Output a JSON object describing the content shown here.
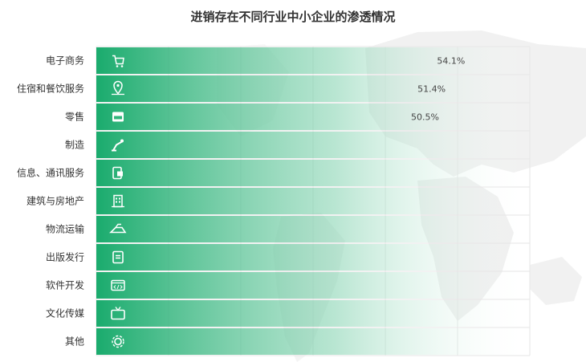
{
  "chart_data": {
    "type": "bar",
    "orientation": "horizontal",
    "title": "进销存在不同行业中小企业的渗透情况",
    "categories": [
      "电子商务",
      "住宿和餐饮服务",
      "零售",
      "制造",
      "信息、通讯服务",
      "建筑与房地产",
      "物流运输",
      "出版发行",
      "软件开发",
      "文化传媒",
      "其他"
    ],
    "icons": [
      "shopping-cart-icon",
      "map-pin-icon",
      "storefront-icon",
      "robot-arm-icon",
      "mobile-phone-icon",
      "building-icon",
      "speedboat-icon",
      "book-icon",
      "code-window-icon",
      "tv-icon",
      "gear-icon"
    ],
    "values": [
      54.1,
      51.4,
      50.5,
      null,
      null,
      null,
      null,
      null,
      null,
      null,
      null
    ],
    "value_labels": [
      "54.1%",
      "51.4%",
      "50.5%",
      "",
      "",
      "",
      "",
      "",
      "",
      "",
      ""
    ],
    "xlim": [
      0,
      60
    ],
    "grid": true,
    "colors": {
      "bar_start": "#1aab6d",
      "bar_end": "#ffffff",
      "icon": "#ffffff"
    }
  }
}
